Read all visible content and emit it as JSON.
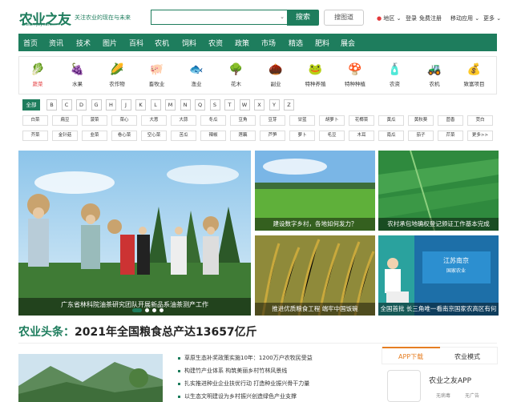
{
  "header": {
    "logo": "农业之友",
    "logo_url": "www.nyzy.com",
    "slogan": "关注农业的现在与未来",
    "search_button": "搜索",
    "image_search": "搜图道",
    "region": "地区",
    "login": "登录",
    "register": "免费注册",
    "mobile": "移动应用",
    "more": "更多"
  },
  "nav": [
    "首页",
    "资讯",
    "技术",
    "图片",
    "百科",
    "农机",
    "饲料",
    "农资",
    "政策",
    "市场",
    "精选",
    "肥料",
    "展会"
  ],
  "categories": [
    {
      "label": "蔬菜",
      "icon": "leafy-vegetable-icon",
      "glyph": "🥬",
      "color": "#8bc34a"
    },
    {
      "label": "水果",
      "icon": "grape-icon",
      "glyph": "🍇",
      "color": "#7b3f99"
    },
    {
      "label": "农作物",
      "icon": "corn-icon",
      "glyph": "🌽",
      "color": "#f4b400"
    },
    {
      "label": "畜牧业",
      "icon": "pig-icon",
      "glyph": "🐖",
      "color": "#c08a60"
    },
    {
      "label": "渔业",
      "icon": "fish-icon",
      "glyph": "🐟",
      "color": "#666"
    },
    {
      "label": "花木",
      "icon": "tree-icon",
      "glyph": "🌳",
      "color": "#4caf50"
    },
    {
      "label": "副业",
      "icon": "nut-icon",
      "glyph": "🌰",
      "color": "#c0763a"
    },
    {
      "label": "特种养殖",
      "icon": "frog-icon",
      "glyph": "🐸",
      "color": "#7cb342"
    },
    {
      "label": "特种种植",
      "icon": "mushroom-icon",
      "glyph": "🍄",
      "color": "#d2691e"
    },
    {
      "label": "农资",
      "icon": "fertilizer-bag-icon",
      "glyph": "🧴",
      "color": "#e6b800"
    },
    {
      "label": "农机",
      "icon": "tractor-icon",
      "glyph": "🚜",
      "color": "#e53935"
    },
    {
      "label": "致富项目",
      "icon": "coin-icon",
      "glyph": "💰",
      "color": "#e65100"
    }
  ],
  "letters": [
    "全部",
    "B",
    "C",
    "D",
    "G",
    "H",
    "J",
    "K",
    "L",
    "M",
    "N",
    "Q",
    "S",
    "T",
    "W",
    "X",
    "Y",
    "Z"
  ],
  "veg_row1": [
    "白菜",
    "扁豆",
    "菠菜",
    "菜心",
    "大葱",
    "大蒜",
    "冬瓜",
    "豆角",
    "豆芽",
    "甘蓝",
    "胡萝卜",
    "花椰菜",
    "黄瓜",
    "黄秋葵",
    "茴香",
    "茭白"
  ],
  "veg_row2": [
    "芥菜",
    "金针菇",
    "韭菜",
    "卷心菜",
    "空心菜",
    "苦瓜",
    "辣椒",
    "莲藕",
    "芦笋",
    "萝卜",
    "毛豆",
    "木耳",
    "南瓜",
    "茄子",
    "芹菜",
    "更多>>"
  ],
  "slides": {
    "main_caption": "广东省林科院油茶研究团队开展新品系油茶测产工作",
    "small": [
      "建设数字乡村，各地如何发力？",
      "农村承包地确权登记颁证工作基本完成",
      "推进优质粮食工程 端牢中国饭碗",
      "全国首批 长三角唯一看南京国家农高区有何特别之处？"
    ]
  },
  "headline": {
    "prefix": "农业头条：",
    "title": "2021年全国粮食总产达13657亿斤"
  },
  "news": [
    "草原生态补奖政策实施10年：1200万户农牧民受益",
    "构建竹产业体系 构筑美丽乡村竹林风景线",
    "扎实推进种业企业扶优行动 打造种业振兴骨干力量",
    "以生态文明建设为乡村振兴创造绿色产业支撑"
  ],
  "sidebar": {
    "tab_app": "APP下载",
    "tab_mode": "农业模式",
    "app_name": "农业之友APP",
    "app_tag1": "无病毒",
    "app_tag2": "无广告"
  }
}
